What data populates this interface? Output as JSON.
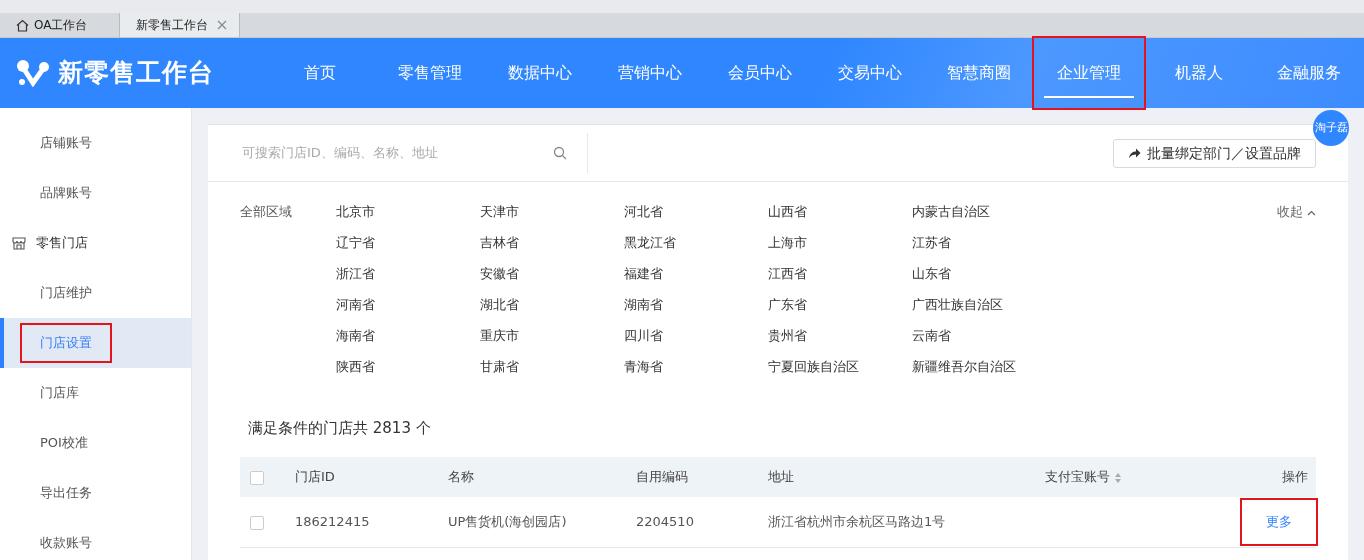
{
  "browser_tabs": [
    {
      "label": "OA工作台",
      "kind": "home",
      "selected": false
    },
    {
      "label": "新零售工作台",
      "kind": "closable",
      "selected": true
    }
  ],
  "header": {
    "logo": "新零售工作台",
    "nav": [
      {
        "label": "首页",
        "selected": false,
        "highlighted": false
      },
      {
        "label": "零售管理",
        "selected": false,
        "highlighted": false
      },
      {
        "label": "数据中心",
        "selected": false,
        "highlighted": false
      },
      {
        "label": "营销中心",
        "selected": false,
        "highlighted": false
      },
      {
        "label": "会员中心",
        "selected": false,
        "highlighted": false
      },
      {
        "label": "交易中心",
        "selected": false,
        "highlighted": false
      },
      {
        "label": "智慧商圈",
        "selected": false,
        "highlighted": false
      },
      {
        "label": "企业管理",
        "selected": true,
        "highlighted": true
      },
      {
        "label": "机器人",
        "selected": false,
        "highlighted": false
      },
      {
        "label": "金融服务",
        "selected": false,
        "highlighted": false
      }
    ],
    "avatar": "淘子磊"
  },
  "sidebar": {
    "items": [
      {
        "label": "店铺账号",
        "kind": "item",
        "selected": false,
        "highlighted": false
      },
      {
        "label": "品牌账号",
        "kind": "item",
        "selected": false,
        "highlighted": false
      },
      {
        "label": "零售门店",
        "kind": "group",
        "selected": false,
        "highlighted": false
      },
      {
        "label": "门店维护",
        "kind": "item",
        "selected": false,
        "highlighted": false
      },
      {
        "label": "门店设置",
        "kind": "item",
        "selected": true,
        "highlighted": true
      },
      {
        "label": "门店库",
        "kind": "item",
        "selected": false,
        "highlighted": false
      },
      {
        "label": "POI校准",
        "kind": "item",
        "selected": false,
        "highlighted": false
      },
      {
        "label": "导出任务",
        "kind": "item",
        "selected": false,
        "highlighted": false
      },
      {
        "label": "收款账号",
        "kind": "item",
        "selected": false,
        "highlighted": false
      }
    ]
  },
  "search": {
    "placeholder": "可搜索门店ID、编码、名称、地址"
  },
  "bulk_button": "批量绑定部门／设置品牌",
  "regions": {
    "label": "全部区域",
    "collapse": "收起",
    "items": [
      "北京市",
      "天津市",
      "河北省",
      "山西省",
      "内蒙古自治区",
      "辽宁省",
      "吉林省",
      "黑龙江省",
      "上海市",
      "江苏省",
      "浙江省",
      "安徽省",
      "福建省",
      "江西省",
      "山东省",
      "河南省",
      "湖北省",
      "湖南省",
      "广东省",
      "广西壮族自治区",
      "海南省",
      "重庆市",
      "四川省",
      "贵州省",
      "云南省",
      "陕西省",
      "甘肃省",
      "青海省",
      "宁夏回族自治区",
      "新疆维吾尔自治区"
    ]
  },
  "result_count": "满足条件的门店共 2813 个",
  "table": {
    "all_checked": false,
    "columns": [
      {
        "label": "门店ID",
        "sortable": false
      },
      {
        "label": "名称",
        "sortable": false
      },
      {
        "label": "自用编码",
        "sortable": false
      },
      {
        "label": "地址",
        "sortable": false
      },
      {
        "label": "支付宝账号",
        "sortable": true
      },
      {
        "label": "操作",
        "sortable": false
      }
    ],
    "rows": [
      {
        "checked": false,
        "cells": [
          "186212415",
          "UP售货机(海创园店)",
          "2204510",
          "浙江省杭州市余杭区马路边1号",
          ""
        ],
        "action": "更多",
        "action_highlighted": true
      }
    ]
  }
}
